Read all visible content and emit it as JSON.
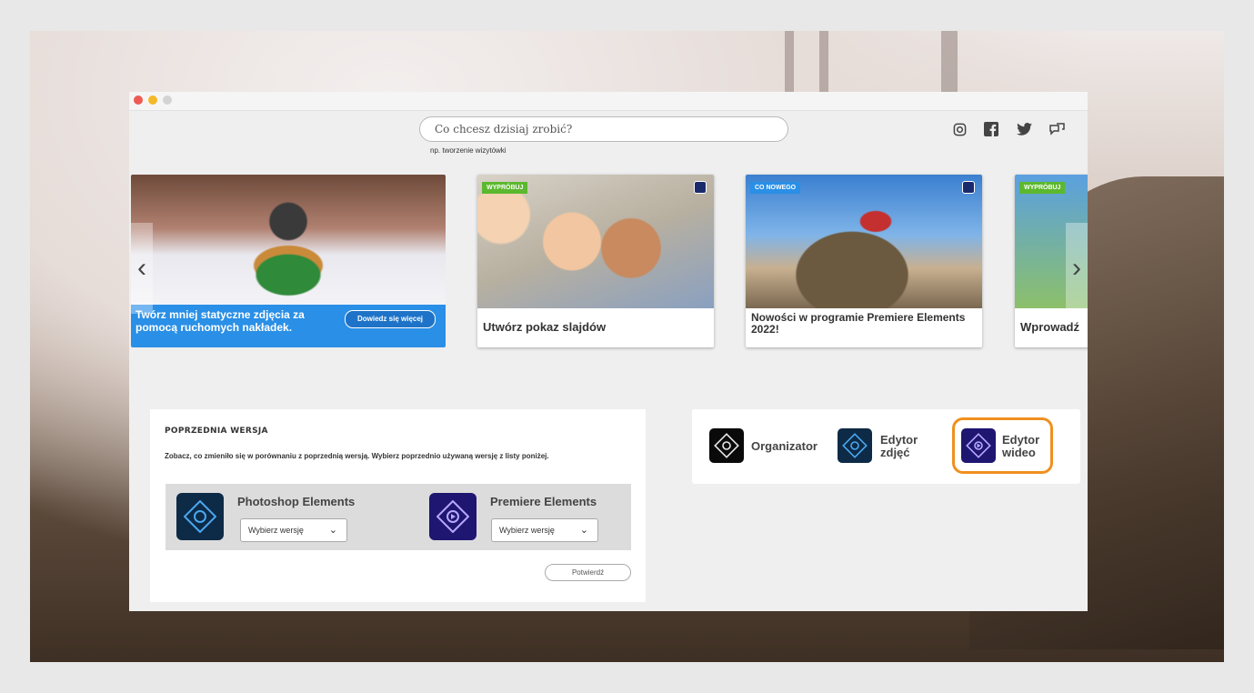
{
  "search": {
    "placeholder": "Co chcesz dzisiaj zrobić?",
    "hint": "np. tworzenie wizytówki"
  },
  "social": [
    "instagram-icon",
    "facebook-icon",
    "twitter-icon",
    "feedback-icon"
  ],
  "carousel": {
    "cards": [
      {
        "caption": "Twórz mniej statyczne zdjęcia za pomocą ruchomych nakładek.",
        "button": "Dowiedz się więcej"
      },
      {
        "badge": "WYPRÓBUJ",
        "caption": "Utwórz pokaz slajdów"
      },
      {
        "badge": "CO NOWEGO",
        "caption": "Nowości w programie Premiere Elements 2022!"
      },
      {
        "badge": "WYPRÓBUJ",
        "caption": "Wprowadź"
      }
    ],
    "prev": "‹",
    "next": "›"
  },
  "previous_version": {
    "title": "POPRZEDNIA WERSJA",
    "description": "Zobacz, co zmieniło się w porównaniu z poprzednią wersją. Wybierz poprzednio używaną wersję z listy poniżej.",
    "products": [
      {
        "name": "Photoshop Elements",
        "select": "Wybierz wersję"
      },
      {
        "name": "Premiere Elements",
        "select": "Wybierz wersję"
      }
    ],
    "confirm": "Potwierdź"
  },
  "launcher": {
    "items": [
      {
        "label": "Organizator"
      },
      {
        "label_line1": "Edytor",
        "label_line2": "zdjęć"
      },
      {
        "label_line1": "Edytor",
        "label_line2": "wideo"
      }
    ]
  },
  "colors": {
    "accent_blue": "#2a8fe6",
    "badge_green": "#5cb82e",
    "highlight_orange": "#f0901e"
  }
}
